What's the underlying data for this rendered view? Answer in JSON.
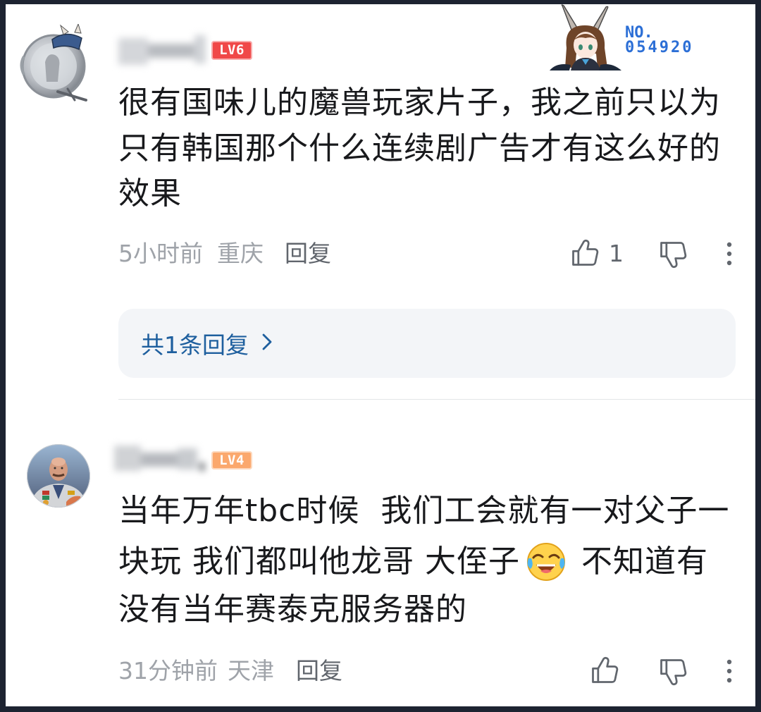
{
  "colors": {
    "text_primary": "#18191c",
    "text_meta": "#9fa3a9",
    "text_reply": "#61666d",
    "link_blue": "#1e5f9e",
    "reply_box_bg": "#f3f5f8",
    "divider": "#e3e5e7",
    "frame": "#1d2331"
  },
  "icons": {
    "like": "thumb-up-icon",
    "dislike": "thumb-down-icon",
    "more": "more-vertical-icon",
    "expand": "chevron-right-icon"
  },
  "comments": [
    {
      "avatar_icon": "avatar-hat-pendant-icon",
      "level": "LV6",
      "level_color": "#f04848",
      "decoration": {
        "character_icon": "anime-rabbit-ear-girl-icon",
        "label": "NO.",
        "number": "054920",
        "color": "#2c6fd6"
      },
      "lines": [
        "很有国味儿的魔兽玩家片子，我之前只以为",
        "只有韩国那个什么连续剧广告才有这么好的",
        "效果"
      ],
      "time": "5小时前",
      "location": "重庆",
      "reply_label": "回复",
      "like_count": "1",
      "replies_summary": "共1条回复"
    },
    {
      "avatar_icon": "avatar-officer-icon",
      "level": "LV4",
      "level_color": "#fba86d",
      "lines": [
        "当年万年tbc时候  我们工会就有一对父子一",
        "块玩 我们都叫他龙哥 大侄子",
        "不知道有",
        "没有当年赛泰克服务器的"
      ],
      "emoji_icon": "laughing-crying-emoji-icon",
      "time": "31分钟前",
      "location": "天津",
      "reply_label": "回复"
    }
  ]
}
